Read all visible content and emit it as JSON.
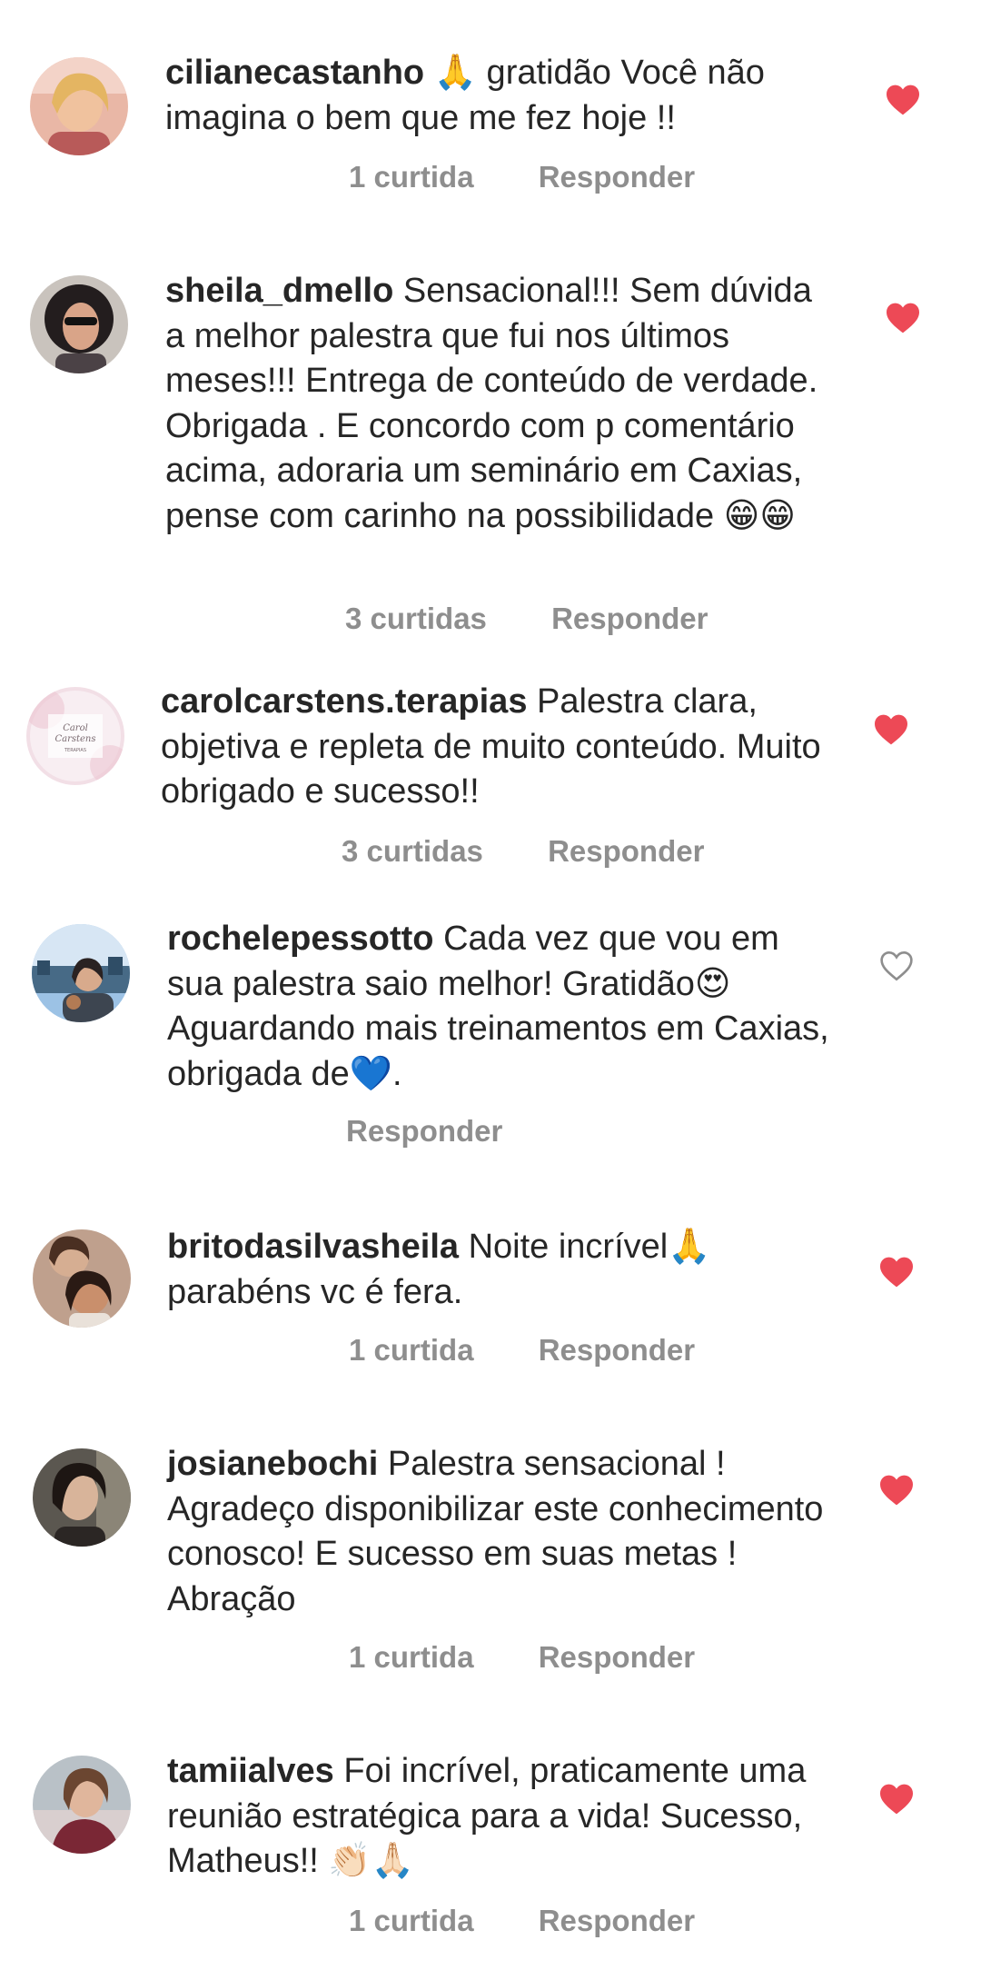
{
  "colors": {
    "like_red": "#ed4956",
    "meta_gray": "#8e8e8e",
    "text": "#262626"
  },
  "comments": [
    {
      "username": "cilianecastanho",
      "text": "🙏 gratidão Você não imagina o bem que me fez hoje !!",
      "likes": "1 curtida",
      "reply": "Responder",
      "liked": true
    },
    {
      "username": "sheila_dmello",
      "text": "Sensacional!!! Sem dúvida a melhor palestra que fui nos últimos meses!!! Entrega de conteúdo de verdade. Obrigada . E concordo com p comentário acima, adoraria um seminário em Caxias, pense com carinho na possibilidade 😁😁",
      "likes": "3 curtidas",
      "reply": "Responder",
      "liked": true
    },
    {
      "username": "carolcarstens.terapias",
      "text": "Palestra clara, objetiva e repleta de muito conteúdo. Muito obrigado e sucesso!!",
      "likes": "3 curtidas",
      "reply": "Responder",
      "liked": true,
      "avatar_text": [
        "Carol",
        "Carstens",
        "TERAPIAS"
      ]
    },
    {
      "username": "rochelepessotto",
      "text": "Cada vez que vou em sua palestra saio melhor! Gratidão😍 Aguardando mais treinamentos em Caxias, obrigada de💙.",
      "likes": "",
      "reply": "Responder",
      "liked": false
    },
    {
      "username": "britodasilvasheila",
      "text": "Noite incrível🙏 parabéns vc é fera.",
      "likes": "1 curtida",
      "reply": "Responder",
      "liked": true
    },
    {
      "username": "josianebochi",
      "text": "Palestra sensacional ! Agradeço disponibilizar este conhecimento conosco! E sucesso em suas metas ! Abração",
      "likes": "1 curtida",
      "reply": "Responder",
      "liked": true
    },
    {
      "username": "tamiialves",
      "text": "Foi incrível, praticamente uma reunião estratégica para a vida! Sucesso, Matheus!! 👏🏻🙏🏻",
      "likes": "1 curtida",
      "reply": "Responder",
      "liked": true
    }
  ]
}
